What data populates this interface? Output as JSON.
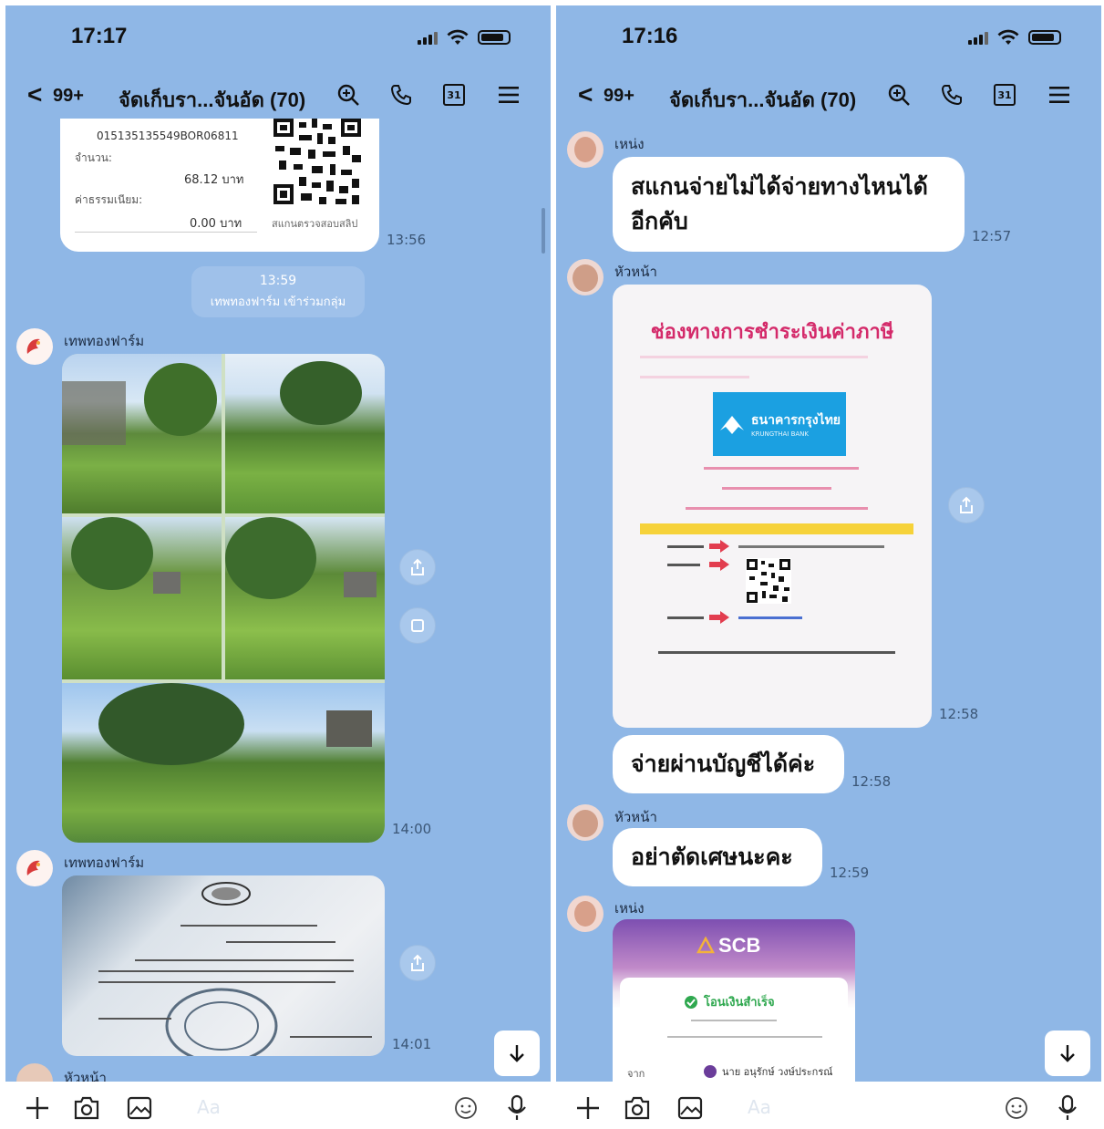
{
  "left": {
    "time": "17:17",
    "unread": "99+",
    "chat_title": "จัดเก็บรา...จันอัด (70)",
    "receipt": {
      "ref": "015135135549BOR06811",
      "amount_label": "จำนวน:",
      "amount_value": "68.12 บาท",
      "fee_label": "ค่าธรรมเนียม:",
      "fee_value": "0.00 บาท",
      "qr_caption": "สแกนตรวจสอบสลิป",
      "time": "13:56"
    },
    "system_notice": {
      "time": "13:59",
      "text": "เทพทองฟาร์ม เข้าร่วมกลุ่ม"
    },
    "msg_photos": {
      "sender": "เทพทองฟาร์ม",
      "time": "14:00"
    },
    "msg_document": {
      "sender": "เทพทองฟาร์ม",
      "time": "14:01"
    },
    "next_sender": "หัวหน้า",
    "input_placeholder": "Aa"
  },
  "right": {
    "time": "17:16",
    "unread": "99+",
    "chat_title": "จัดเก็บรา...จันอัด (70)",
    "msg1": {
      "sender": "เหน่ง",
      "line1": "สแกนจ่ายไม่ได้จ่ายทางไหนได้",
      "line2": "อีกคับ",
      "time": "12:57"
    },
    "msg2": {
      "sender": "หัวหน้า",
      "poster_title": "ช่องทางการชำระเงินค่าภาษี",
      "bank_name": "ธนาคารกรุงไทย",
      "bank_name_en": "KRUNGTHAI BANK",
      "time": "12:58"
    },
    "msg3": {
      "text": "จ่ายผ่านบัญชีได้ค่ะ",
      "time": "12:58"
    },
    "msg4": {
      "sender": "หัวหน้า",
      "text": "อย่าตัดเศษนะคะ",
      "time": "12:59"
    },
    "msg5": {
      "sender": "เหน่ง",
      "slip_brand": "SCB",
      "slip_status": "โอนเงินสำเร็จ",
      "slip_from_label": "จาก",
      "slip_from_name": "นาย อนุรักษ์ วงษ์ประกรณ์"
    },
    "input_placeholder": "Aa"
  },
  "colors": {
    "chat_bg": "#8fb7e6",
    "bubble": "#ffffff",
    "poster_title": "#d42a6a",
    "bank_blue": "#1ba0e1"
  }
}
